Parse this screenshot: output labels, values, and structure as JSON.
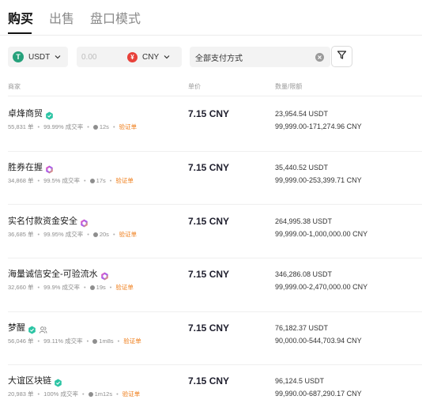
{
  "tabs": [
    {
      "label": "购买",
      "active": true
    },
    {
      "label": "出售",
      "active": false
    },
    {
      "label": "盘口模式",
      "active": false
    }
  ],
  "filters": {
    "coin": {
      "icon": "tether-icon",
      "label": "USDT"
    },
    "amount_placeholder": "0.00",
    "currency": {
      "icon": "yuan-icon",
      "label": "CNY"
    },
    "payment": "全部支付方式"
  },
  "columns": {
    "merchant": "商家",
    "price": "单价",
    "amount": "数量/限额"
  },
  "colors": {
    "accent_orange": "#ef7d19",
    "tether_green": "#26a17b",
    "yuan_red": "#e8413a"
  },
  "rows": [
    {
      "name": "卓烽商贸",
      "badge": "teal",
      "orders": "55,831 单",
      "completion": "99.99% 成交率",
      "time": "12s",
      "verify": "验证单",
      "price": "7.15 CNY",
      "quantity": "23,954.54 USDT",
      "limit": "99,999.00-171,274.96 CNY"
    },
    {
      "name": "胜券在握",
      "badge": "gradient",
      "orders": "34,868 单",
      "completion": "99.5% 成交率",
      "time": "17s",
      "verify": "验证单",
      "price": "7.15 CNY",
      "quantity": "35,440.52 USDT",
      "limit": "99,999.00-253,399.71 CNY"
    },
    {
      "name": "实名付款资金安全",
      "badge": "gradient",
      "orders": "36,685 单",
      "completion": "99.95% 成交率",
      "time": "20s",
      "verify": "验证单",
      "price": "7.15 CNY",
      "quantity": "264,995.38 USDT",
      "limit": "99,999.00-1,000,000.00 CNY"
    },
    {
      "name": "海量诚信安全-可验流水",
      "badge": "gradient",
      "orders": "32,660 单",
      "completion": "99.9% 成交率",
      "time": "19s",
      "verify": "验证单",
      "price": "7.15 CNY",
      "quantity": "346,286.08 USDT",
      "limit": "99,999.00-2,470,000.00 CNY"
    },
    {
      "name": "梦醒",
      "badge": "teal",
      "extra_icon": true,
      "orders": "56,046 单",
      "completion": "99.11% 成交率",
      "time": "1m8s",
      "verify": "验证单",
      "price": "7.15 CNY",
      "quantity": "76,182.37 USDT",
      "limit": "90,000.00-544,703.94 CNY"
    },
    {
      "name": "大谊区块链",
      "badge": "teal",
      "orders": "20,983 单",
      "completion": "100% 成交率",
      "time": "1m12s",
      "verify": "验证单",
      "price": "7.15 CNY",
      "quantity": "96,124.5 USDT",
      "limit": "99,990.00-687,290.17 CNY"
    }
  ]
}
